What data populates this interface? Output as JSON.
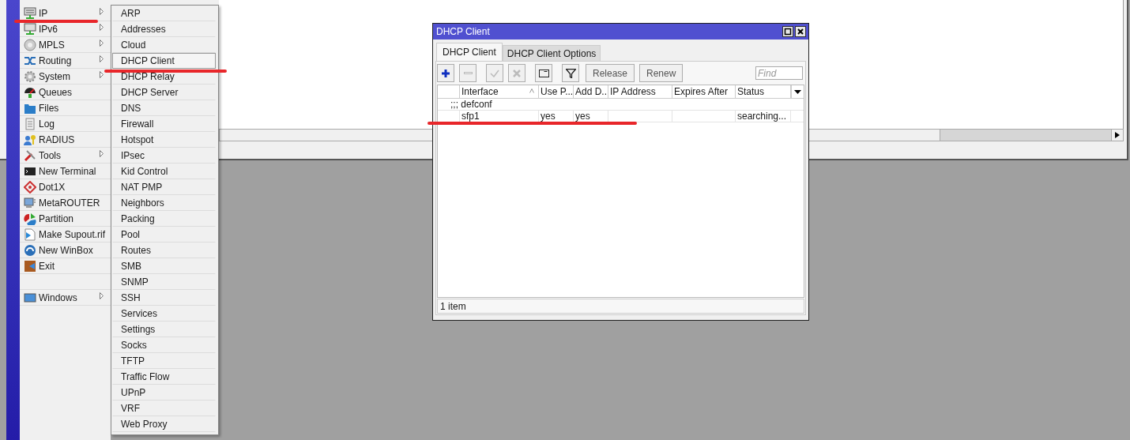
{
  "main_menu": {
    "items": [
      {
        "label": "IP",
        "has_submenu": true,
        "underlined": true
      },
      {
        "label": "IPv6",
        "has_submenu": true,
        "underlined": false
      },
      {
        "label": "MPLS",
        "has_submenu": true,
        "underlined": false
      },
      {
        "label": "Routing",
        "has_submenu": true,
        "underlined": false
      },
      {
        "label": "System",
        "has_submenu": true,
        "underlined": false
      },
      {
        "label": "Queues",
        "has_submenu": false,
        "underlined": false
      },
      {
        "label": "Files",
        "has_submenu": false,
        "underlined": false
      },
      {
        "label": "Log",
        "has_submenu": false,
        "underlined": false
      },
      {
        "label": "RADIUS",
        "has_submenu": false,
        "underlined": false
      },
      {
        "label": "Tools",
        "has_submenu": true,
        "underlined": false
      },
      {
        "label": "New Terminal",
        "has_submenu": false,
        "underlined": false
      },
      {
        "label": "Dot1X",
        "has_submenu": false,
        "underlined": false
      },
      {
        "label": "MetaROUTER",
        "has_submenu": false,
        "underlined": false
      },
      {
        "label": "Partition",
        "has_submenu": false,
        "underlined": false
      },
      {
        "label": "Make Supout.rif",
        "has_submenu": false,
        "underlined": false
      },
      {
        "label": "New WinBox",
        "has_submenu": false,
        "underlined": false
      },
      {
        "label": "Exit",
        "has_submenu": false,
        "underlined": false
      }
    ],
    "footer_items": [
      {
        "label": "Windows",
        "has_submenu": true,
        "underlined": false
      }
    ]
  },
  "ip_submenu": {
    "items": [
      {
        "label": "ARP",
        "selected": false,
        "underlined": false
      },
      {
        "label": "Addresses",
        "selected": false,
        "underlined": false
      },
      {
        "label": "Cloud",
        "selected": false,
        "underlined": false
      },
      {
        "label": "DHCP Client",
        "selected": true,
        "underlined": true
      },
      {
        "label": "DHCP Relay",
        "selected": false,
        "underlined": false
      },
      {
        "label": "DHCP Server",
        "selected": false,
        "underlined": false
      },
      {
        "label": "DNS",
        "selected": false,
        "underlined": false
      },
      {
        "label": "Firewall",
        "selected": false,
        "underlined": false
      },
      {
        "label": "Hotspot",
        "selected": false,
        "underlined": false
      },
      {
        "label": "IPsec",
        "selected": false,
        "underlined": false
      },
      {
        "label": "Kid Control",
        "selected": false,
        "underlined": false
      },
      {
        "label": "NAT PMP",
        "selected": false,
        "underlined": false
      },
      {
        "label": "Neighbors",
        "selected": false,
        "underlined": false
      },
      {
        "label": "Packing",
        "selected": false,
        "underlined": false
      },
      {
        "label": "Pool",
        "selected": false,
        "underlined": false
      },
      {
        "label": "Routes",
        "selected": false,
        "underlined": false
      },
      {
        "label": "SMB",
        "selected": false,
        "underlined": false
      },
      {
        "label": "SNMP",
        "selected": false,
        "underlined": false
      },
      {
        "label": "SSH",
        "selected": false,
        "underlined": false
      },
      {
        "label": "Services",
        "selected": false,
        "underlined": false
      },
      {
        "label": "Settings",
        "selected": false,
        "underlined": false
      },
      {
        "label": "Socks",
        "selected": false,
        "underlined": false
      },
      {
        "label": "TFTP",
        "selected": false,
        "underlined": false
      },
      {
        "label": "Traffic Flow",
        "selected": false,
        "underlined": false
      },
      {
        "label": "UPnP",
        "selected": false,
        "underlined": false
      },
      {
        "label": "VRF",
        "selected": false,
        "underlined": false
      },
      {
        "label": "Web Proxy",
        "selected": false,
        "underlined": false
      }
    ]
  },
  "dhcp_window": {
    "title": "DHCP Client",
    "tabs": [
      {
        "label": "DHCP Client",
        "selected": true
      },
      {
        "label": "DHCP Client Options",
        "selected": false
      }
    ],
    "toolbar": [
      {
        "kind": "add",
        "disabled": false
      },
      {
        "kind": "remove",
        "disabled": true
      },
      {
        "kind": "enable",
        "disabled": true
      },
      {
        "kind": "disable",
        "disabled": true
      },
      {
        "kind": "comment",
        "disabled": false
      },
      {
        "kind": "filter",
        "disabled": false
      },
      {
        "kind": "text",
        "label": "Release",
        "disabled": false
      },
      {
        "kind": "text",
        "label": "Renew",
        "disabled": false
      }
    ],
    "search": {
      "placeholder": "Find"
    },
    "table": {
      "columns": [
        {
          "label": "Interface",
          "sorted": true
        },
        {
          "label": "Use P...",
          "sorted": false
        },
        {
          "label": "Add D...",
          "sorted": false
        },
        {
          "label": "IP Address",
          "sorted": false
        },
        {
          "label": "Expires After",
          "sorted": false
        },
        {
          "label": "Status",
          "sorted": false
        }
      ],
      "rows": [
        {
          "kind": "comment",
          "text": ";;; defconf",
          "underlined": false
        },
        {
          "kind": "data",
          "cells": [
            "sfp1",
            "yes",
            "yes",
            "",
            "",
            "searching..."
          ],
          "underlined": true
        }
      ]
    },
    "status_bar": "1 item"
  }
}
